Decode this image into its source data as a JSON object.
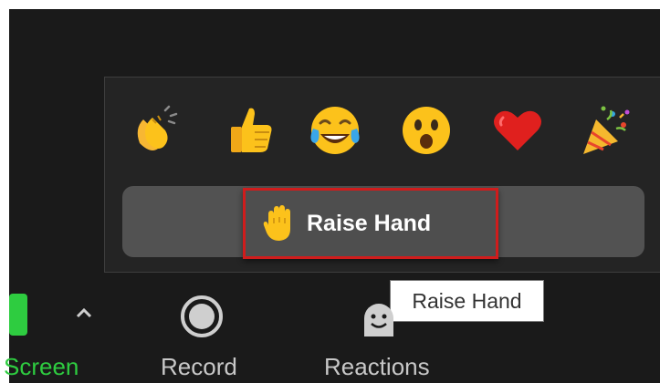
{
  "reactions_popup": {
    "emojis": [
      {
        "name": "clapping-hands"
      },
      {
        "name": "thumbs-up"
      },
      {
        "name": "tears-of-joy"
      },
      {
        "name": "open-mouth"
      },
      {
        "name": "red-heart"
      },
      {
        "name": "party-popper"
      }
    ],
    "raise_hand_label": "Raise Hand"
  },
  "tooltip": {
    "text": "Raise Hand"
  },
  "toolbar": {
    "share_label": "Screen",
    "record_label": "Record",
    "reactions_label": "Reactions"
  },
  "colors": {
    "background": "#1a1a1a",
    "popup": "#242424",
    "raise_bar": "#525252",
    "highlight": "#d01c1c",
    "share_green": "#2ecc40"
  }
}
